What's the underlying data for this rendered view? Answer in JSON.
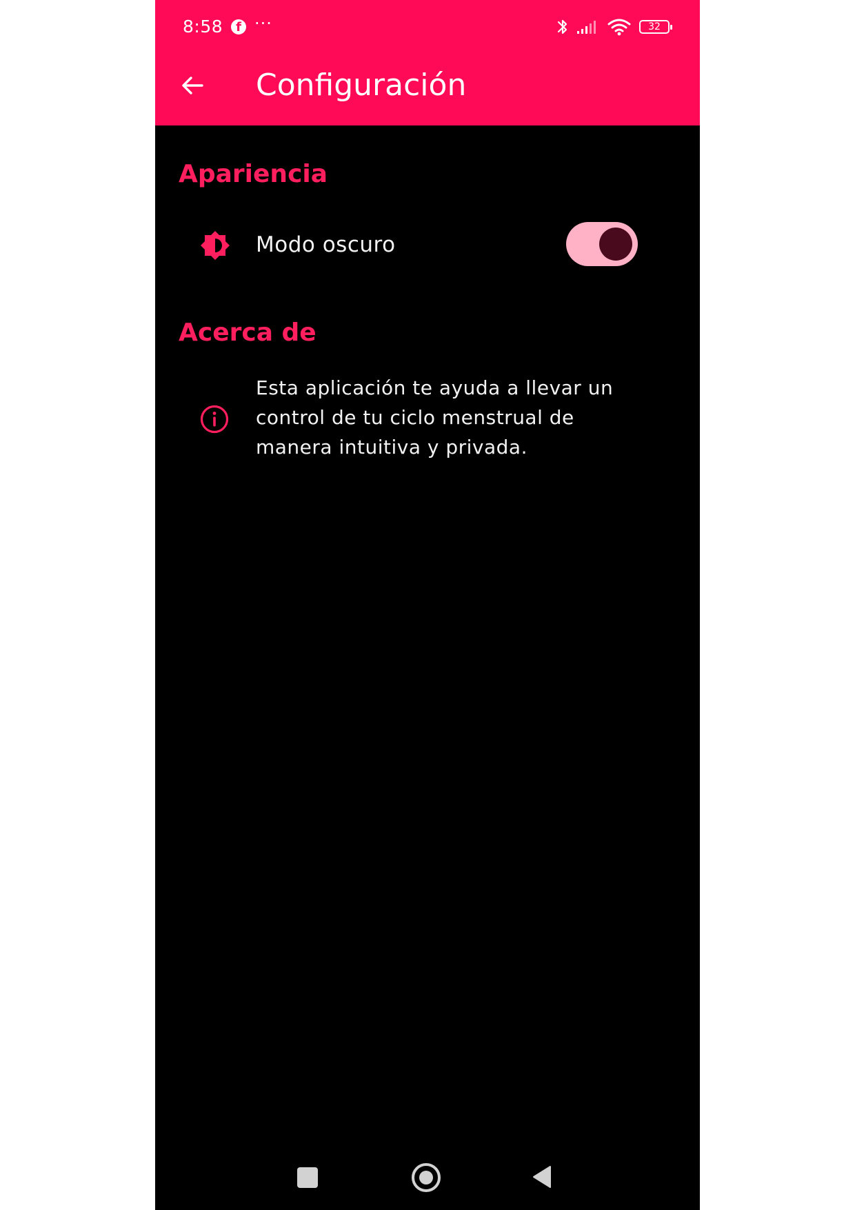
{
  "status_bar": {
    "time": "8:58",
    "notification_icon": "facebook-icon",
    "more_indicator": "···",
    "battery_level": "32"
  },
  "app_bar": {
    "title": "Configuración",
    "back_icon": "arrow-left-icon"
  },
  "sections": {
    "appearance": {
      "header": "Apariencia",
      "dark_mode": {
        "label": "Modo oscuro",
        "icon": "brightness-icon",
        "enabled": true
      }
    },
    "about": {
      "header": "Acerca de",
      "icon": "info-icon",
      "description": "Esta aplicación te ayuda a llevar un control de tu ciclo menstrual de manera intuitiva y privada."
    }
  },
  "colors": {
    "primary": "#ff0a57",
    "accent_text": "#ff1e5e",
    "background": "#000000",
    "toggle_track": "#ffb1c6",
    "toggle_thumb": "#4a0a1d"
  }
}
